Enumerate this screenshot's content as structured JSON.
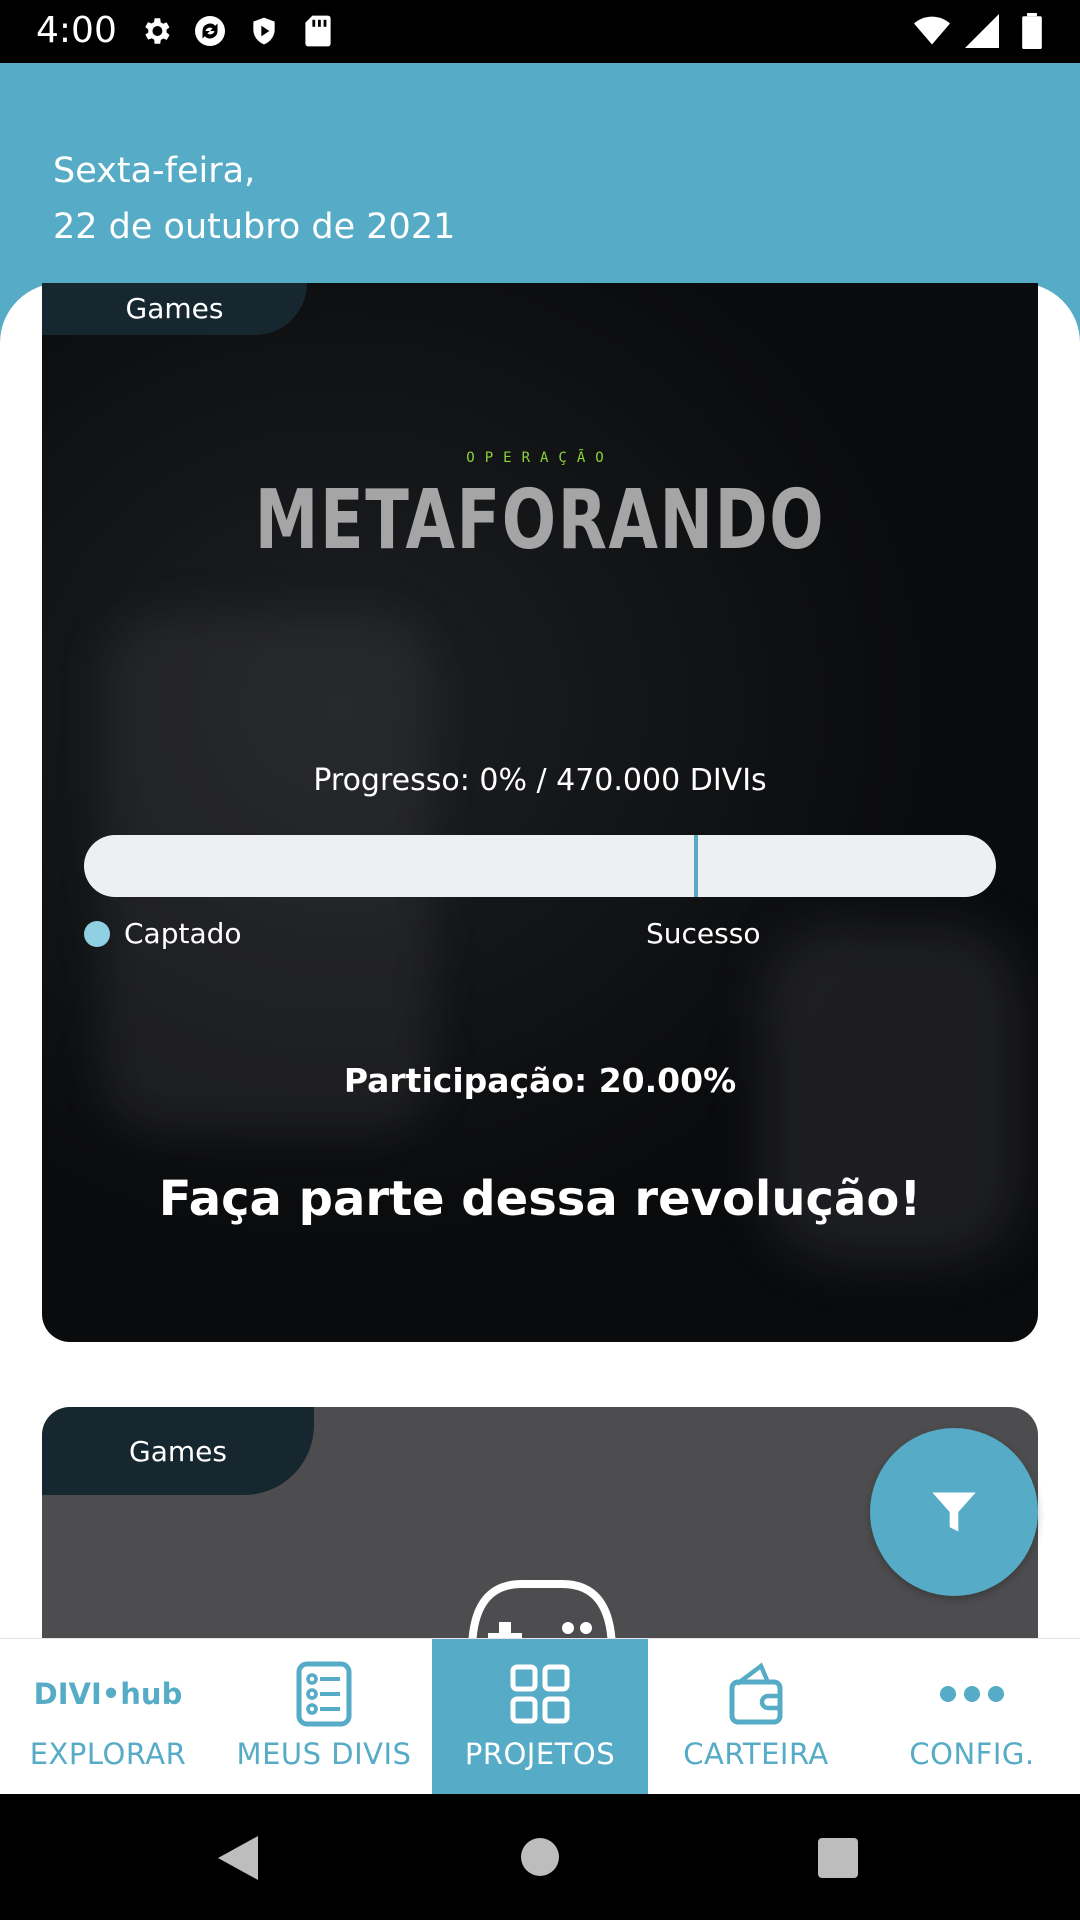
{
  "status_bar": {
    "time": "4:00",
    "left_icons": [
      "settings-icon",
      "sync-icon",
      "shield-icon",
      "sd-card-icon"
    ],
    "right_icons": [
      "wifi-icon",
      "signal-icon",
      "battery-icon"
    ]
  },
  "header": {
    "weekday": "Sexta-feira,",
    "date": "22 de outubro de 2021"
  },
  "projects": [
    {
      "category": "Games",
      "logo_small": "OPERAÇÃO",
      "logo_title": "METAFORANDO",
      "progress_text": "Progresso: 0% / 470.000 DIVIs",
      "progress": 0,
      "legend_raised": "Captado",
      "legend_success": "Sucesso",
      "participation": "Participação: 20.00%",
      "cta": "Faça parte dessa revolução!"
    },
    {
      "category": "Games",
      "image_icon": "gamepad-icon"
    }
  ],
  "fab": {
    "icon": "filter-icon"
  },
  "bottom_nav": {
    "items": [
      {
        "label": "EXPLORAR",
        "logo": [
          "DIVI",
          "•hub"
        ],
        "icon": "divi-hub-logo",
        "active": false
      },
      {
        "label": "MEUS DIVIS",
        "icon": "list-icon",
        "active": false
      },
      {
        "label": "PROJETOS",
        "icon": "grid-icon",
        "active": true
      },
      {
        "label": "CARTEIRA",
        "icon": "wallet-icon",
        "active": false
      },
      {
        "label": "CONFIG.",
        "icon": "more-icon",
        "active": false
      }
    ]
  },
  "colors": {
    "primary": "#56abc6",
    "tag_bg": "#172730",
    "logo_accent": "#8cd33a"
  }
}
